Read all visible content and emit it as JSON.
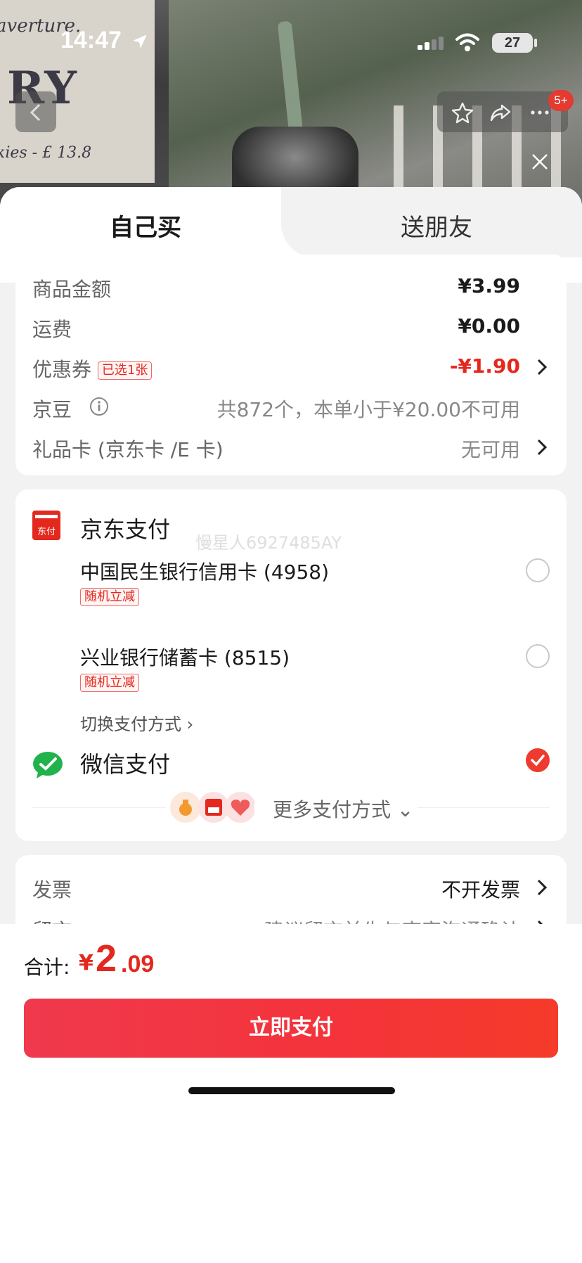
{
  "status_bar": {
    "time": "14:47",
    "battery": "27"
  },
  "photo": {
    "line1": "averture.",
    "line2": "RY",
    "line3": "kies - £ 13.8"
  },
  "nav": {
    "badge": "5+"
  },
  "tabs": {
    "self_buy": "自己买",
    "gift_friend": "送朋友"
  },
  "summary": {
    "goods_label": "商品金额",
    "goods_value": "¥3.99",
    "shipping_label": "运费",
    "shipping_value": "¥0.00",
    "coupon_label": "优惠券",
    "coupon_tag": "已选1张",
    "coupon_value": "-¥1.90",
    "jd_bean_label": "京豆",
    "jd_bean_value": "共872个，本单小于¥20.00不可用",
    "gift_card_label": "礼品卡 (京东卡 /E 卡)",
    "gift_card_value": "无可用"
  },
  "payment": {
    "jd_pay_logo_text": "东付",
    "jd_pay_title": "京东支付",
    "watermark": "慢星人6927485AY",
    "card1_name": "中国民生银行信用卡 (4958)",
    "card1_tag": "随机立减",
    "card2_name": "兴业银行储蓄卡 (8515)",
    "card2_tag": "随机立减",
    "switch_label": "切换支付方式",
    "wechat_title": "微信支付",
    "more_label": "更多支付方式"
  },
  "extras": {
    "invoice_label": "发票",
    "invoice_value": "不开发票",
    "note_label": "留言",
    "note_value": "建议留言前先与商家沟通确认"
  },
  "footer": {
    "total_label": "合计:",
    "currency": "¥",
    "total_int": "2",
    "total_dec": ".09",
    "pay_button": "立即支付"
  },
  "colors": {
    "accent_red": "#e4281e",
    "wechat_green": "#22b24c"
  }
}
